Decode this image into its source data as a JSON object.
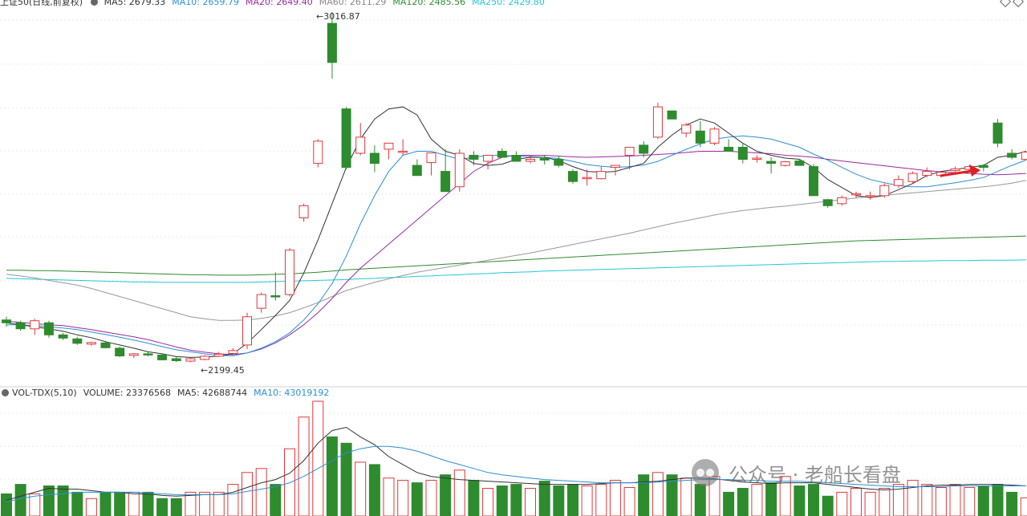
{
  "header": {
    "symbol": "上证50(日线,前复权)",
    "ma_items": [
      {
        "label": "MA5: 2679.33",
        "color": "#333333"
      },
      {
        "label": "MA10: 2659.79",
        "color": "#2a8fd8"
      },
      {
        "label": "MA20: 2649.40",
        "color": "#9a2aa0"
      },
      {
        "label": "MA60: 2611.29",
        "color": "#888888"
      },
      {
        "label": "MA120: 2485.56",
        "color": "#2e8b2e"
      },
      {
        "label": "MA250: 2429.80",
        "color": "#22c8d8"
      }
    ]
  },
  "volume_header": {
    "indicator": "VOL-TDX(5,10)",
    "volume": "VOLUME: 23376568",
    "ma5": "MA5: 42688744",
    "ma10": "MA10: 43019192"
  },
  "annotations": {
    "high": "3016.87",
    "low": "2199.45"
  },
  "watermark": "公众号 · 老船长看盘",
  "colors": {
    "up": "#e0393b",
    "down": "#2e8b2e",
    "arrow": "#e02020"
  },
  "chart_data": {
    "type": "candlestick",
    "price_range": [
      2170,
      3045
    ],
    "candles": [
      [
        2282,
        2290,
        2265,
        2275
      ],
      [
        2275,
        2280,
        2255,
        2260
      ],
      [
        2260,
        2285,
        2245,
        2280
      ],
      [
        2275,
        2280,
        2238,
        2245
      ],
      [
        2245,
        2250,
        2232,
        2237
      ],
      [
        2235,
        2240,
        2220,
        2224
      ],
      [
        2222,
        2228,
        2218,
        2226
      ],
      [
        2225,
        2230,
        2212,
        2213
      ],
      [
        2212,
        2216,
        2190,
        2193
      ],
      [
        2194,
        2200,
        2188,
        2198
      ],
      [
        2198,
        2202,
        2192,
        2195
      ],
      [
        2195,
        2199,
        2182,
        2183
      ],
      [
        2186,
        2190,
        2178,
        2181
      ],
      [
        2180,
        2188,
        2177,
        2186
      ],
      [
        2184,
        2195,
        2182,
        2192
      ],
      [
        2192,
        2203,
        2190,
        2197
      ],
      [
        2199,
        2212,
        2195,
        2206
      ],
      [
        2220,
        2300,
        2210,
        2290
      ],
      [
        2311,
        2350,
        2300,
        2345
      ],
      [
        2342,
        2400,
        2330,
        2340
      ],
      [
        2345,
        2460,
        2340,
        2455
      ],
      [
        2535,
        2570,
        2525,
        2565
      ],
      [
        2670,
        2730,
        2660,
        2725
      ],
      [
        3016.87,
        3045,
        2880,
        2920
      ],
      [
        2805,
        2810,
        2655,
        2660
      ],
      [
        2695,
        2770,
        2690,
        2735
      ],
      [
        2695,
        2715,
        2648,
        2670
      ],
      [
        2705,
        2720,
        2680,
        2720
      ],
      [
        2700,
        2730,
        2690,
        2700
      ],
      [
        2665,
        2680,
        2640,
        2640
      ],
      [
        2672,
        2696,
        2640,
        2696
      ],
      [
        2650,
        2705,
        2600,
        2600
      ],
      [
        2612,
        2705,
        2600,
        2695
      ],
      [
        2690,
        2700,
        2665,
        2680
      ],
      [
        2675,
        2690,
        2655,
        2690
      ],
      [
        2700,
        2707,
        2690,
        2685
      ],
      [
        2690,
        2700,
        2675,
        2675
      ],
      [
        2675,
        2690,
        2670,
        2680
      ],
      [
        2682,
        2690,
        2667,
        2678
      ],
      [
        2680,
        2688,
        2660,
        2665
      ],
      [
        2650,
        2655,
        2620,
        2625
      ],
      [
        2635,
        2655,
        2615,
        2635
      ],
      [
        2632,
        2662,
        2630,
        2650
      ],
      [
        2660,
        2665,
        2640,
        2665
      ],
      [
        2690,
        2702,
        2655,
        2710
      ],
      [
        2715,
        2725,
        2685,
        2695
      ],
      [
        2735,
        2820,
        2730,
        2810
      ],
      [
        2800,
        2800,
        2780,
        2780
      ],
      [
        2745,
        2770,
        2735,
        2765
      ],
      [
        2750,
        2775,
        2710,
        2720
      ],
      [
        2720,
        2760,
        2715,
        2755
      ],
      [
        2710,
        2730,
        2700,
        2700
      ],
      [
        2710,
        2720,
        2670,
        2680
      ],
      [
        2680,
        2690,
        2672,
        2683
      ],
      [
        2675,
        2685,
        2645,
        2670
      ],
      [
        2665,
        2676,
        2662,
        2674
      ],
      [
        2676,
        2680,
        2665,
        2665
      ],
      [
        2662,
        2668,
        2590,
        2590
      ],
      [
        2580,
        2582,
        2560,
        2565
      ],
      [
        2570,
        2590,
        2565,
        2585
      ],
      [
        2595,
        2600,
        2585,
        2595
      ],
      [
        2590,
        2600,
        2580,
        2590
      ],
      [
        2590,
        2620,
        2585,
        2615
      ],
      [
        2615,
        2640,
        2610,
        2630
      ],
      [
        2625,
        2650,
        2620,
        2645
      ],
      [
        2640,
        2660,
        2635,
        2650
      ],
      [
        2640,
        2650,
        2635,
        2648
      ],
      [
        2652,
        2662,
        2645,
        2656
      ],
      [
        2655,
        2665,
        2650,
        2662
      ],
      [
        2665,
        2668,
        2650,
        2660
      ],
      [
        2770,
        2780,
        2710,
        2720
      ],
      [
        2695,
        2705,
        2680,
        2685
      ],
      [
        2680,
        2700,
        2678,
        2698
      ]
    ],
    "ma5": [
      2275,
      2270,
      2265,
      2260,
      2254,
      2245,
      2238,
      2228,
      2220,
      2212,
      2203,
      2198,
      2191,
      2189,
      2190,
      2192,
      2198,
      2224,
      2258,
      2293,
      2330,
      2398,
      2480,
      2570,
      2660,
      2730,
      2780,
      2805,
      2810,
      2790,
      2730,
      2700,
      2690,
      2670,
      2665,
      2668,
      2680,
      2685,
      2685,
      2677,
      2662,
      2650,
      2648,
      2650,
      2660,
      2670,
      2710,
      2740,
      2765,
      2780,
      2770,
      2745,
      2720,
      2700,
      2690,
      2683,
      2680,
      2660,
      2630,
      2610,
      2590,
      2585,
      2590,
      2605,
      2620,
      2640,
      2650,
      2655,
      2660,
      2665,
      2685,
      2690,
      2700
    ],
    "ma10": [
      2270,
      2270,
      2268,
      2265,
      2262,
      2258,
      2252,
      2246,
      2239,
      2232,
      2224,
      2216,
      2208,
      2203,
      2198,
      2194,
      2193,
      2200,
      2212,
      2228,
      2250,
      2282,
      2322,
      2372,
      2440,
      2520,
      2590,
      2650,
      2690,
      2700,
      2700,
      2690,
      2680,
      2685,
      2690,
      2690,
      2688,
      2687,
      2685,
      2682,
      2675,
      2667,
      2663,
      2660,
      2662,
      2666,
      2675,
      2690,
      2705,
      2718,
      2730,
      2735,
      2738,
      2735,
      2730,
      2720,
      2710,
      2693,
      2678,
      2660,
      2643,
      2630,
      2622,
      2615,
      2612,
      2612,
      2617,
      2622,
      2628,
      2635,
      2650,
      2665,
      2678
    ],
    "ma20": [
      2279,
      2276,
      2273,
      2270,
      2268,
      2263,
      2258,
      2252,
      2246,
      2240,
      2233,
      2224,
      2215,
      2207,
      2202,
      2198,
      2196,
      2200,
      2210,
      2225,
      2245,
      2270,
      2300,
      2335,
      2375,
      2410,
      2440,
      2470,
      2500,
      2530,
      2560,
      2590,
      2620,
      2650,
      2670,
      2685,
      2690,
      2690,
      2690,
      2688,
      2686,
      2685,
      2686,
      2687,
      2688,
      2690,
      2692,
      2694,
      2697,
      2700,
      2700,
      2700,
      2698,
      2696,
      2694,
      2690,
      2688,
      2685,
      2680,
      2676,
      2672,
      2668,
      2664,
      2660,
      2656,
      2652,
      2649,
      2647,
      2645,
      2643,
      2642,
      2643,
      2645
    ],
    "ma60": [
      2395,
      2391,
      2386,
      2380,
      2374,
      2368,
      2360,
      2350,
      2340,
      2330,
      2320,
      2310,
      2300,
      2290,
      2285,
      2281,
      2281,
      2282,
      2286,
      2292,
      2300,
      2312,
      2325,
      2340,
      2355,
      2365,
      2375,
      2384,
      2392,
      2400,
      2406,
      2412,
      2418,
      2424,
      2430,
      2436,
      2442,
      2448,
      2455,
      2462,
      2469,
      2476,
      2483,
      2490,
      2497,
      2505,
      2513,
      2521,
      2528,
      2535,
      2542,
      2548,
      2553,
      2557,
      2561,
      2564,
      2568,
      2572,
      2576,
      2580,
      2584,
      2588,
      2591,
      2594,
      2597,
      2600,
      2603,
      2606,
      2609,
      2612,
      2616,
      2621,
      2628
    ],
    "ma120": [
      2405,
      2405,
      2404,
      2404,
      2403,
      2402,
      2401,
      2400,
      2399,
      2398,
      2397,
      2396,
      2395,
      2394,
      2394,
      2393,
      2393,
      2393,
      2394,
      2395,
      2396,
      2398,
      2400,
      2403,
      2406,
      2408,
      2410,
      2412,
      2414,
      2416,
      2418,
      2420,
      2422,
      2424,
      2426,
      2428,
      2430,
      2432,
      2434,
      2436,
      2438,
      2440,
      2442,
      2444,
      2446,
      2448,
      2450,
      2452,
      2454,
      2456,
      2458,
      2460,
      2462,
      2464,
      2466,
      2468,
      2470,
      2472,
      2474,
      2476,
      2478,
      2479,
      2480,
      2481,
      2482,
      2483,
      2484,
      2485,
      2486,
      2487,
      2488,
      2489,
      2490
    ],
    "ma250": [
      2385,
      2384,
      2383,
      2382,
      2381,
      2380,
      2379,
      2378,
      2377,
      2376,
      2376,
      2375,
      2375,
      2375,
      2375,
      2375,
      2375,
      2375,
      2376,
      2377,
      2378,
      2379,
      2380,
      2381,
      2382,
      2384,
      2385,
      2387,
      2388,
      2390,
      2391,
      2393,
      2394,
      2396,
      2397,
      2399,
      2400,
      2401,
      2403,
      2404,
      2405,
      2406,
      2407,
      2408,
      2409,
      2410,
      2411,
      2412,
      2413,
      2414,
      2415,
      2416,
      2417,
      2418,
      2419,
      2420,
      2421,
      2422,
      2423,
      2424,
      2425,
      2426,
      2427,
      2427,
      2428,
      2428,
      2429,
      2429,
      2429,
      2430,
      2430,
      2430,
      2431
    ],
    "volume": {
      "max": 145,
      "bars": [
        28,
        40,
        28,
        38,
        38,
        30,
        22,
        30,
        30,
        30,
        30,
        22,
        22,
        30,
        30,
        30,
        40,
        55,
        60,
        40,
        85,
        125,
        145,
        100,
        92,
        68,
        65,
        48,
        45,
        42,
        45,
        52,
        58,
        45,
        35,
        38,
        40,
        35,
        44,
        38,
        40,
        38,
        40,
        45,
        36,
        52,
        55,
        52,
        48,
        40,
        50,
        30,
        35,
        40,
        42,
        50,
        38,
        40,
        25,
        30,
        35,
        30,
        35,
        40,
        45,
        40,
        36,
        40,
        36,
        38,
        40,
        30,
        23
      ],
      "ma5": [
        20,
        25,
        30,
        35,
        34,
        34,
        32,
        30,
        30,
        28,
        28,
        26,
        25,
        26,
        27,
        27,
        30,
        36,
        42,
        46,
        54,
        70,
        92,
        108,
        112,
        100,
        90,
        75,
        65,
        55,
        50,
        48,
        46,
        45,
        44,
        43,
        42,
        41,
        40,
        40,
        40,
        40,
        41,
        42,
        42,
        43,
        44,
        46,
        48,
        48,
        47,
        45,
        43,
        42,
        41,
        42,
        42,
        42,
        40,
        38,
        36,
        34,
        33,
        34,
        36,
        38,
        39,
        39,
        40,
        40,
        40,
        39,
        38
      ],
      "ma10": [
        18,
        22,
        25,
        27,
        28,
        30,
        30,
        30,
        30,
        30,
        29,
        28,
        27,
        27,
        27,
        27,
        28,
        31,
        34,
        37,
        42,
        50,
        60,
        70,
        80,
        85,
        88,
        88,
        86,
        82,
        76,
        70,
        65,
        60,
        55,
        52,
        50,
        48,
        46,
        45,
        44,
        43,
        42,
        42,
        42,
        42,
        43,
        44,
        45,
        46,
        46,
        46,
        45,
        45,
        44,
        44,
        44,
        43,
        42,
        41,
        40,
        39,
        38,
        37,
        37,
        37,
        37,
        38,
        38,
        38,
        38,
        38,
        38
      ]
    }
  }
}
